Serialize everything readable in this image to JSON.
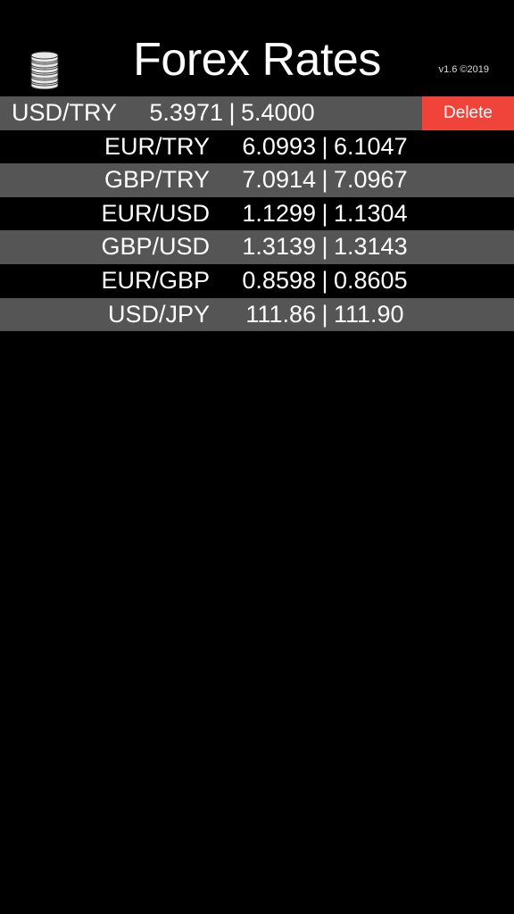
{
  "header": {
    "title": "Forex Rates",
    "version": "v1.6 ©2019",
    "icon": "coin-stack-icon"
  },
  "rates": [
    {
      "pair": "USD/TRY",
      "bid": "5.3971",
      "separator": "|",
      "ask": "5.4000",
      "swiped": true,
      "delete_label": "Delete"
    },
    {
      "pair": "EUR/TRY",
      "bid": "6.0993",
      "separator": "|",
      "ask": "6.1047"
    },
    {
      "pair": "GBP/TRY",
      "bid": "7.0914",
      "separator": "|",
      "ask": "7.0967"
    },
    {
      "pair": "EUR/USD",
      "bid": "1.1299",
      "separator": "|",
      "ask": "1.1304"
    },
    {
      "pair": "GBP/USD",
      "bid": "1.3139",
      "separator": "|",
      "ask": "1.3143"
    },
    {
      "pair": "EUR/GBP",
      "bid": "0.8598",
      "separator": "|",
      "ask": "0.8605"
    },
    {
      "pair": "USD/JPY",
      "bid": "111.86",
      "separator": "|",
      "ask": "111.90"
    }
  ],
  "colors": {
    "background": "#000000",
    "row_alt": "#555555",
    "delete": "#f0433a",
    "text": "#ffffff"
  }
}
